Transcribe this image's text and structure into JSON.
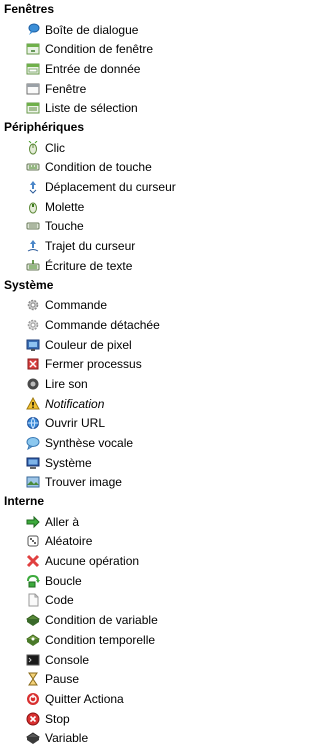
{
  "categories": [
    {
      "label": "Fenêtres",
      "items": [
        {
          "label": "Boîte de dialogue",
          "icon": "dialog-icon"
        },
        {
          "label": "Condition de fenêtre",
          "icon": "window-condition-icon"
        },
        {
          "label": "Entrée de donnée",
          "icon": "data-input-icon"
        },
        {
          "label": "Fenêtre",
          "icon": "window-icon"
        },
        {
          "label": "Liste de sélection",
          "icon": "selection-list-icon"
        }
      ]
    },
    {
      "label": "Périphériques",
      "items": [
        {
          "label": "Clic",
          "icon": "mouse-click-icon"
        },
        {
          "label": "Condition de touche",
          "icon": "key-condition-icon"
        },
        {
          "label": "Déplacement du curseur",
          "icon": "cursor-move-icon"
        },
        {
          "label": "Molette",
          "icon": "mouse-wheel-icon"
        },
        {
          "label": "Touche",
          "icon": "keyboard-key-icon"
        },
        {
          "label": "Trajet du curseur",
          "icon": "cursor-path-icon"
        },
        {
          "label": "Écriture de texte",
          "icon": "text-write-icon"
        }
      ]
    },
    {
      "label": "Système",
      "items": [
        {
          "label": "Commande",
          "icon": "gear-icon"
        },
        {
          "label": "Commande détachée",
          "icon": "gear-detached-icon"
        },
        {
          "label": "Couleur de pixel",
          "icon": "pixel-color-icon"
        },
        {
          "label": "Fermer processus",
          "icon": "kill-process-icon"
        },
        {
          "label": "Lire son",
          "icon": "speaker-icon"
        },
        {
          "label": "Notification",
          "icon": "warning-icon",
          "italic": true
        },
        {
          "label": "Ouvrir URL",
          "icon": "globe-icon"
        },
        {
          "label": "Synthèse vocale",
          "icon": "speech-bubble-icon"
        },
        {
          "label": "Système",
          "icon": "monitor-icon"
        },
        {
          "label": "Trouver image",
          "icon": "find-image-icon"
        }
      ]
    },
    {
      "label": "Interne",
      "items": [
        {
          "label": "Aller à",
          "icon": "goto-arrow-icon"
        },
        {
          "label": "Aléatoire",
          "icon": "dice-icon"
        },
        {
          "label": "Aucune opération",
          "icon": "red-cross-icon"
        },
        {
          "label": "Boucle",
          "icon": "loop-icon"
        },
        {
          "label": "Code",
          "icon": "code-page-icon"
        },
        {
          "label": "Condition de variable",
          "icon": "variable-condition-icon"
        },
        {
          "label": "Condition temporelle",
          "icon": "time-condition-icon"
        },
        {
          "label": "Console",
          "icon": "console-icon"
        },
        {
          "label": "Pause",
          "icon": "hourglass-icon"
        },
        {
          "label": "Quitter Actiona",
          "icon": "quit-icon"
        },
        {
          "label": "Stop",
          "icon": "stop-icon"
        },
        {
          "label": "Variable",
          "icon": "variable-icon"
        }
      ]
    }
  ]
}
